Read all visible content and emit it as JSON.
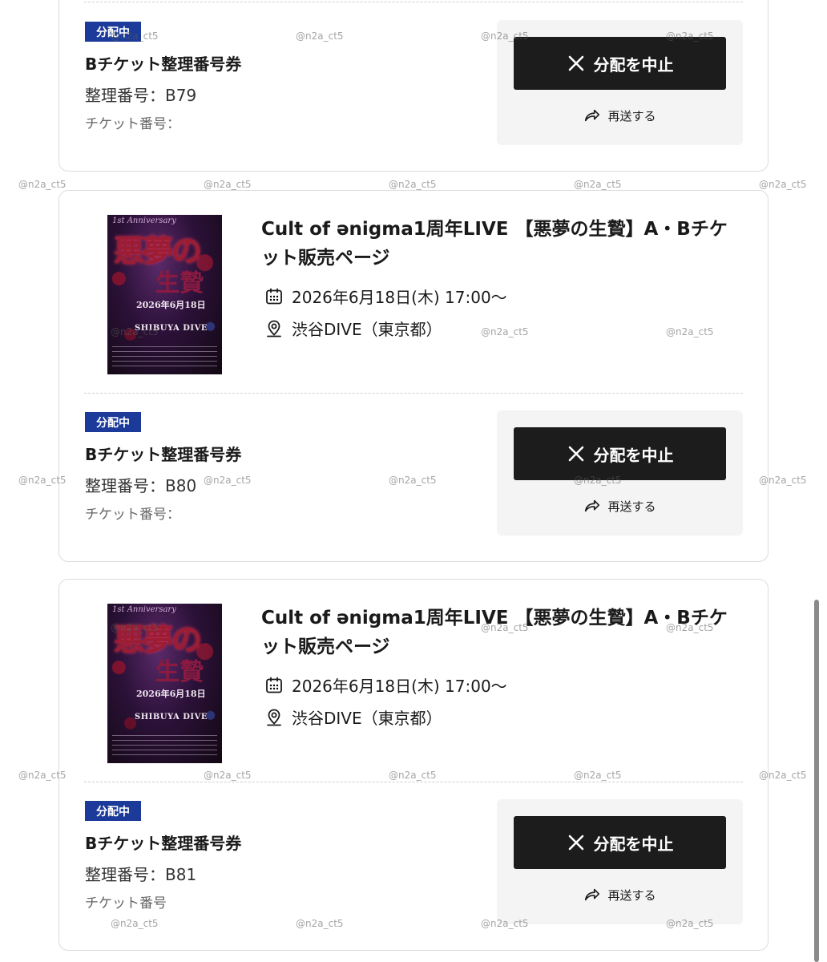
{
  "event": {
    "title": "Cult of ənigma1周年LIVE 【悪夢の生贄】A・Bチケット販売ページ",
    "date": "2026年6月18日(木) 17:00〜",
    "venue": "渋谷DIVE（東京都）",
    "poster": {
      "header": "1st Anniversary",
      "title": "悪夢の",
      "title2": "生贄",
      "date": "2026年6月18日",
      "venue": "SHIBUYA DIVE"
    }
  },
  "tickets": [
    {
      "status": "分配中",
      "name": "Bチケット整理番号券",
      "number": "整理番号：B79",
      "ticket_no": "チケット番号：",
      "stop_label": "分配を中止",
      "resend_label": "再送する"
    },
    {
      "status": "分配中",
      "name": "Bチケット整理番号券",
      "number": "整理番号：B80",
      "ticket_no": "チケット番号：",
      "stop_label": "分配を中止",
      "resend_label": "再送する"
    },
    {
      "status": "分配中",
      "name": "Bチケット整理番号券",
      "number": "整理番号：B81",
      "ticket_no": "チケット番号",
      "stop_label": "分配を中止",
      "resend_label": "再送する"
    }
  ],
  "watermark": "@n2a_ct5",
  "colors": {
    "badge": "#1b3a9a",
    "button": "#1c1c1c",
    "panel": "#f4f4f4",
    "border": "#dcdcdc"
  },
  "icons": {
    "calendar": "calendar-icon",
    "location": "map-pin-icon",
    "close": "close-icon",
    "share": "share-arrow-icon"
  }
}
